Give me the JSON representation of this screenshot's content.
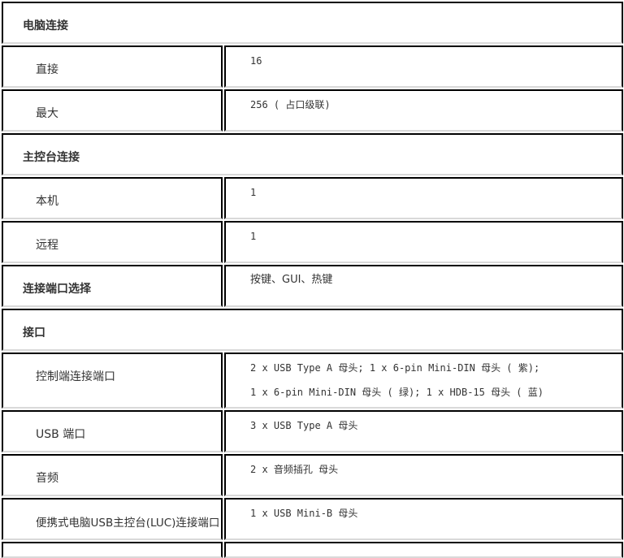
{
  "sections": [
    {
      "title": "电脑连接"
    },
    {
      "title": "主控台连接"
    },
    {
      "title": "接口"
    }
  ],
  "rows": {
    "direct": {
      "label": "直接",
      "value": "16"
    },
    "max": {
      "label": "最大",
      "value": "256 ( 占口级联)"
    },
    "local": {
      "label": "本机",
      "value": "1"
    },
    "remote": {
      "label": "远程",
      "value": "1"
    },
    "port_select": {
      "label": "连接端口选择",
      "value": "按键、GUI、热键"
    },
    "console_ports": {
      "label": "控制端连接端口",
      "value_lines": [
        "2 x USB Type A 母头; 1 x 6-pin Mini-DIN 母头 ( 紫);",
        "1 x 6-pin Mini-DIN 母头 ( 绿); 1 x HDB-15 母头 ( 蓝)"
      ]
    },
    "usb_ports": {
      "label": "USB 端口",
      "value": "3 x USB Type A 母头"
    },
    "audio": {
      "label": "音频",
      "value": "2 x 音频插孔 母头"
    },
    "luc": {
      "label": "便携式电脑USB主控台(LUC)连接端口",
      "value": "1 x USB Mini-B 母头"
    }
  }
}
